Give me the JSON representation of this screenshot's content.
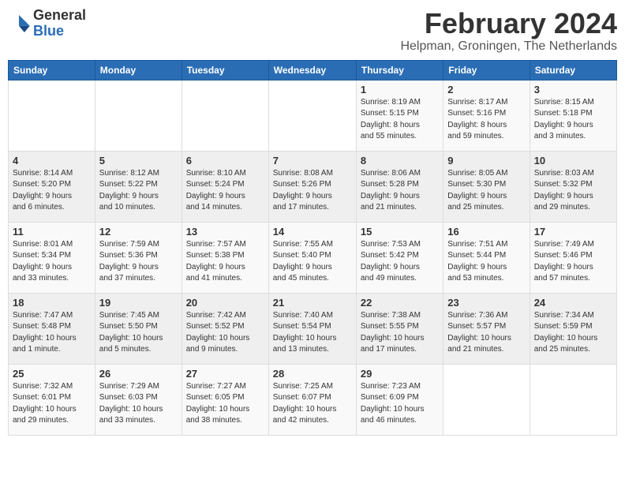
{
  "logo": {
    "text_general": "General",
    "text_blue": "Blue"
  },
  "header": {
    "month_year": "February 2024",
    "location": "Helpman, Groningen, The Netherlands"
  },
  "days_of_week": [
    "Sunday",
    "Monday",
    "Tuesday",
    "Wednesday",
    "Thursday",
    "Friday",
    "Saturday"
  ],
  "weeks": [
    [
      {
        "day": "",
        "info": ""
      },
      {
        "day": "",
        "info": ""
      },
      {
        "day": "",
        "info": ""
      },
      {
        "day": "",
        "info": ""
      },
      {
        "day": "1",
        "info": "Sunrise: 8:19 AM\nSunset: 5:15 PM\nDaylight: 8 hours\nand 55 minutes."
      },
      {
        "day": "2",
        "info": "Sunrise: 8:17 AM\nSunset: 5:16 PM\nDaylight: 8 hours\nand 59 minutes."
      },
      {
        "day": "3",
        "info": "Sunrise: 8:15 AM\nSunset: 5:18 PM\nDaylight: 9 hours\nand 3 minutes."
      }
    ],
    [
      {
        "day": "4",
        "info": "Sunrise: 8:14 AM\nSunset: 5:20 PM\nDaylight: 9 hours\nand 6 minutes."
      },
      {
        "day": "5",
        "info": "Sunrise: 8:12 AM\nSunset: 5:22 PM\nDaylight: 9 hours\nand 10 minutes."
      },
      {
        "day": "6",
        "info": "Sunrise: 8:10 AM\nSunset: 5:24 PM\nDaylight: 9 hours\nand 14 minutes."
      },
      {
        "day": "7",
        "info": "Sunrise: 8:08 AM\nSunset: 5:26 PM\nDaylight: 9 hours\nand 17 minutes."
      },
      {
        "day": "8",
        "info": "Sunrise: 8:06 AM\nSunset: 5:28 PM\nDaylight: 9 hours\nand 21 minutes."
      },
      {
        "day": "9",
        "info": "Sunrise: 8:05 AM\nSunset: 5:30 PM\nDaylight: 9 hours\nand 25 minutes."
      },
      {
        "day": "10",
        "info": "Sunrise: 8:03 AM\nSunset: 5:32 PM\nDaylight: 9 hours\nand 29 minutes."
      }
    ],
    [
      {
        "day": "11",
        "info": "Sunrise: 8:01 AM\nSunset: 5:34 PM\nDaylight: 9 hours\nand 33 minutes."
      },
      {
        "day": "12",
        "info": "Sunrise: 7:59 AM\nSunset: 5:36 PM\nDaylight: 9 hours\nand 37 minutes."
      },
      {
        "day": "13",
        "info": "Sunrise: 7:57 AM\nSunset: 5:38 PM\nDaylight: 9 hours\nand 41 minutes."
      },
      {
        "day": "14",
        "info": "Sunrise: 7:55 AM\nSunset: 5:40 PM\nDaylight: 9 hours\nand 45 minutes."
      },
      {
        "day": "15",
        "info": "Sunrise: 7:53 AM\nSunset: 5:42 PM\nDaylight: 9 hours\nand 49 minutes."
      },
      {
        "day": "16",
        "info": "Sunrise: 7:51 AM\nSunset: 5:44 PM\nDaylight: 9 hours\nand 53 minutes."
      },
      {
        "day": "17",
        "info": "Sunrise: 7:49 AM\nSunset: 5:46 PM\nDaylight: 9 hours\nand 57 minutes."
      }
    ],
    [
      {
        "day": "18",
        "info": "Sunrise: 7:47 AM\nSunset: 5:48 PM\nDaylight: 10 hours\nand 1 minute."
      },
      {
        "day": "19",
        "info": "Sunrise: 7:45 AM\nSunset: 5:50 PM\nDaylight: 10 hours\nand 5 minutes."
      },
      {
        "day": "20",
        "info": "Sunrise: 7:42 AM\nSunset: 5:52 PM\nDaylight: 10 hours\nand 9 minutes."
      },
      {
        "day": "21",
        "info": "Sunrise: 7:40 AM\nSunset: 5:54 PM\nDaylight: 10 hours\nand 13 minutes."
      },
      {
        "day": "22",
        "info": "Sunrise: 7:38 AM\nSunset: 5:55 PM\nDaylight: 10 hours\nand 17 minutes."
      },
      {
        "day": "23",
        "info": "Sunrise: 7:36 AM\nSunset: 5:57 PM\nDaylight: 10 hours\nand 21 minutes."
      },
      {
        "day": "24",
        "info": "Sunrise: 7:34 AM\nSunset: 5:59 PM\nDaylight: 10 hours\nand 25 minutes."
      }
    ],
    [
      {
        "day": "25",
        "info": "Sunrise: 7:32 AM\nSunset: 6:01 PM\nDaylight: 10 hours\nand 29 minutes."
      },
      {
        "day": "26",
        "info": "Sunrise: 7:29 AM\nSunset: 6:03 PM\nDaylight: 10 hours\nand 33 minutes."
      },
      {
        "day": "27",
        "info": "Sunrise: 7:27 AM\nSunset: 6:05 PM\nDaylight: 10 hours\nand 38 minutes."
      },
      {
        "day": "28",
        "info": "Sunrise: 7:25 AM\nSunset: 6:07 PM\nDaylight: 10 hours\nand 42 minutes."
      },
      {
        "day": "29",
        "info": "Sunrise: 7:23 AM\nSunset: 6:09 PM\nDaylight: 10 hours\nand 46 minutes."
      },
      {
        "day": "",
        "info": ""
      },
      {
        "day": "",
        "info": ""
      }
    ]
  ]
}
